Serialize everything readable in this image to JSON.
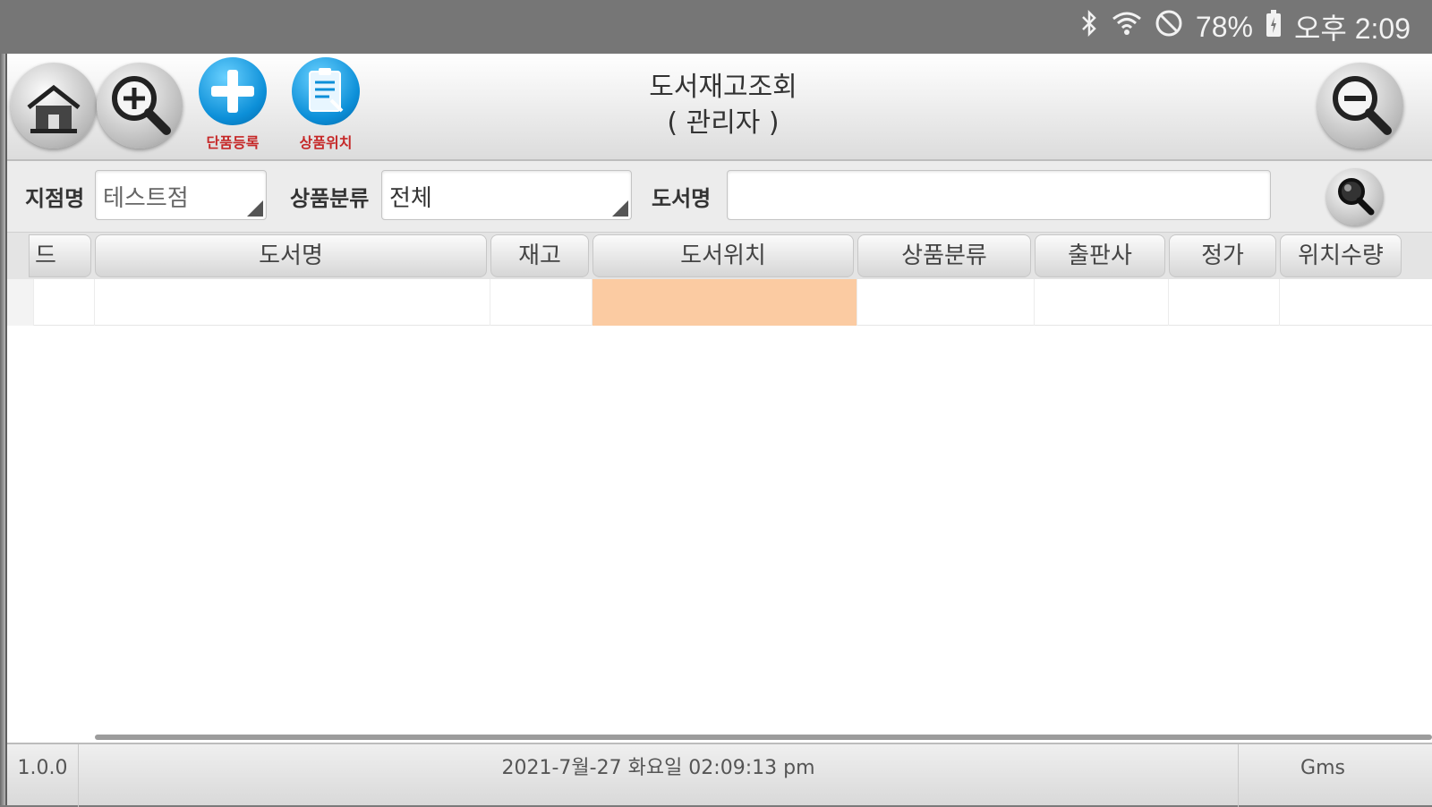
{
  "status_bar": {
    "battery": "78%",
    "time": "오후 2:09",
    "icons": [
      "bluetooth-icon",
      "wifi-icon",
      "do-not-disturb-icon",
      "battery-icon"
    ]
  },
  "toolbar": {
    "title_line1": "도서재고조회",
    "title_line2": "( 관리자 )",
    "add_caption": "단품등록",
    "location_caption": "상품위치"
  },
  "search": {
    "branch_label": "지점명",
    "branch_value": "테스트점",
    "category_label": "상품분류",
    "category_value": "전체",
    "book_label": "도서명",
    "book_value": ""
  },
  "table": {
    "headers": [
      "드",
      "도서명",
      "재고",
      "도서위치",
      "상품분류",
      "출판사",
      "정가",
      "위치수량"
    ],
    "rows": [
      [
        "",
        "",
        "",
        "",
        "",
        "",
        "",
        ""
      ]
    ]
  },
  "footer": {
    "version": "1.0.0",
    "datetime": "2021-7월-27 화요일 02:09:13 pm",
    "brand": "Gms"
  },
  "colors": {
    "highlight_cell": "#fbcba2",
    "accent_blue": "#0c8fd8",
    "caption_red": "#c62828"
  }
}
